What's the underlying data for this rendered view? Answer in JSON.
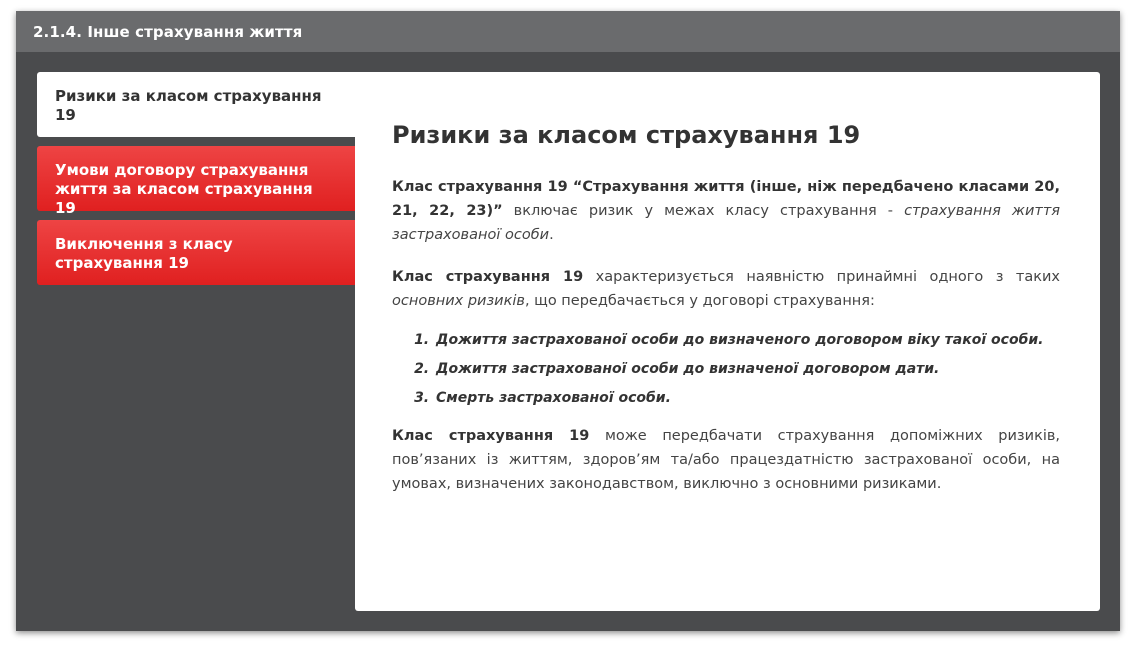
{
  "window": {
    "title": "2.1.4. Інше страхування життя"
  },
  "tabs": [
    {
      "label": "Ризики за класом страхування 19",
      "active": true
    },
    {
      "label": "Умови договору страхування життя за класом страхування 19",
      "active": false
    },
    {
      "label": "Виключення з класу страхування 19",
      "active": false
    }
  ],
  "content": {
    "heading": "Ризики за класом страхування 19",
    "p1": {
      "bold": "Клас страхування 19 “Страхування життя (інше, ніж передбачено класами 20, 21, 22, 23)”",
      "text": " включає ризик у межах класу страхування - ",
      "italic": "страхування життя застрахованої особи",
      "end": "."
    },
    "p2": {
      "bold": "Клас страхування 19",
      "text": " характеризується наявністю принаймні одного з таких ",
      "italic": "основних ризиків",
      "end": ", що передбачається у договорі страхування:"
    },
    "risks": [
      "Дожиття застрахованої особи до визначеного договором віку такої особи.",
      "Дожиття застрахованої особи до визначеної договором дати.",
      "Смерть застрахованої особи."
    ],
    "p3": {
      "bold": "Клас страхування 19",
      "text": " може передбачати страхування допоміжних ризиків, пов’язаних із життям, здоров’ям та/або працездатністю застрахованої особи, на умовах, визначених законодавством, виключно з основними ризиками."
    }
  },
  "colors": {
    "frame_bg": "#4a4b4d",
    "titlebar_bg": "#6a6b6d",
    "tab_inactive": "#e53030",
    "tab_active": "#ffffff"
  }
}
